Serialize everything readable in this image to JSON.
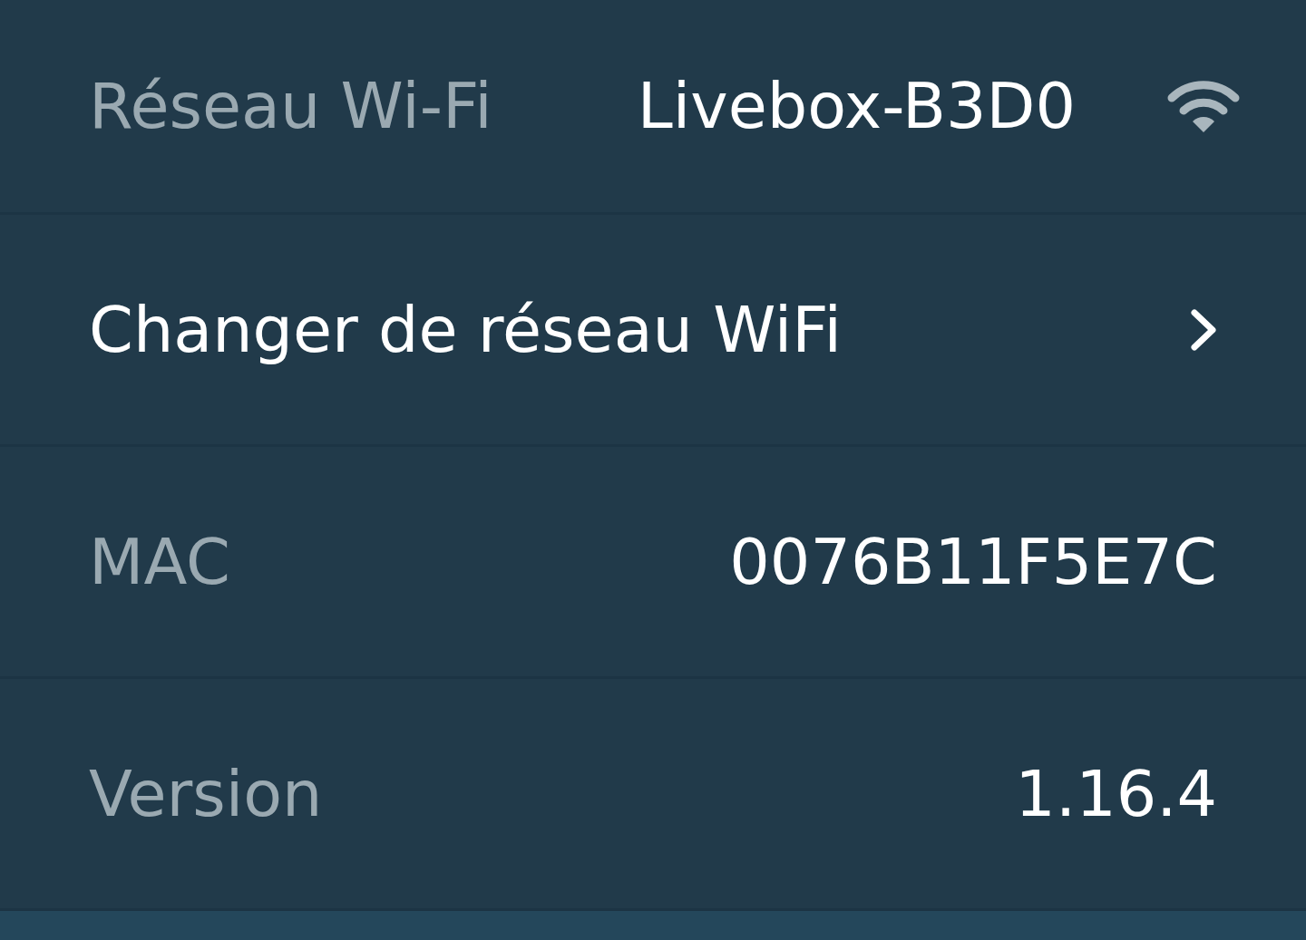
{
  "rows": [
    {
      "kind": "network",
      "label": "Réseau Wi-Fi",
      "value": "Livebox-B3D0"
    },
    {
      "kind": "action",
      "label": "Changer de réseau WiFi"
    },
    {
      "kind": "info",
      "label": "MAC",
      "value": "0076B11F5E7C"
    },
    {
      "kind": "info",
      "label": "Version",
      "value": "1.16.4"
    }
  ]
}
